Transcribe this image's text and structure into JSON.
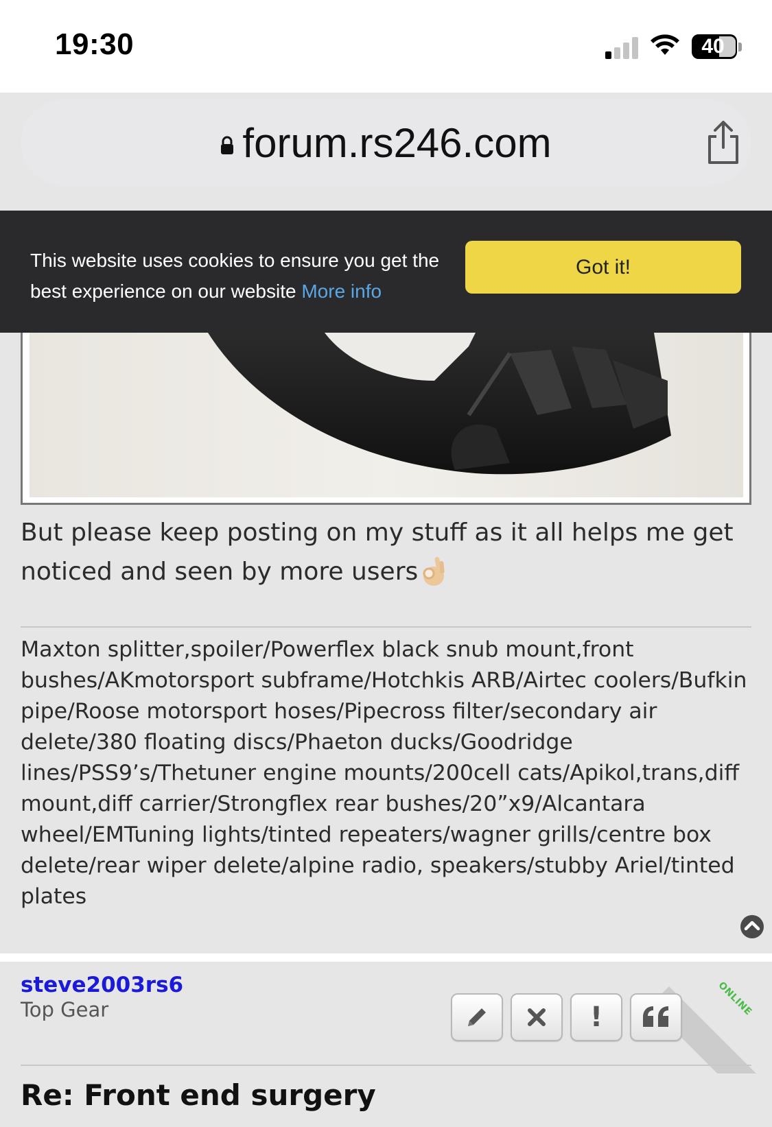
{
  "status_bar": {
    "time": "19:30",
    "battery": "40"
  },
  "browser": {
    "url": "forum.rs246.com"
  },
  "cookie_banner": {
    "message": "This website uses cookies to ensure you get the best experience on our website",
    "more_info": "More info",
    "accept_label": "Got it!"
  },
  "post": {
    "body": "But please keep posting on my stuff as it all helps me get noticed and seen by more users",
    "signature": "Maxton splitter,spoiler/Powerflex black snub mount,front bushes/AKmotorsport subframe/Hotchkis ARB/Airtec coolers/Bufkin pipe/Roose motorsport hoses/Pipecross filter/secondary air delete/380 floating discs/Phaeton ducks/Goodridge lines/PSS9’s/Thetuner engine mounts/200cell cats/Apikol,trans,diff mount,diff carrier/Strongflex rear bushes/20”x9/Alcantara wheel/EMTuning lights/tinted repeaters/wagner grills/centre box delete/rear wiper delete/alpine radio, speakers/stubby Ariel/tinted plates"
  },
  "next_post": {
    "author": "steve2003rs6",
    "rank": "Top Gear",
    "online_badge": "ONLINE",
    "title": "Re: Front end surgery",
    "actions": [
      "edit-icon",
      "delete-icon",
      "report-icon",
      "quote-icon"
    ],
    "report_label": "!"
  },
  "colors": {
    "cookie_bg": "#2a2a2c",
    "accept_button": "#eed646",
    "link": "#5aa7e6",
    "author": "#1a1ad8",
    "online": "#4cbb4c"
  }
}
